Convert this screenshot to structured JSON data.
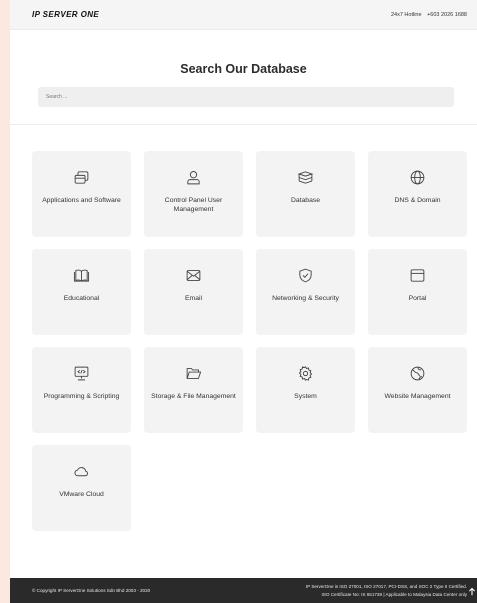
{
  "header": {
    "logo": "IP SERVER ONE",
    "hotline_label": "24x7 Hotline",
    "hotline_number": "+603 2026 1688"
  },
  "main": {
    "title": "Search Our Database",
    "search_placeholder": "Search ...",
    "categories": [
      {
        "label": "Applications and Software",
        "icon": "application-icon"
      },
      {
        "label": "Control Panel User Management",
        "icon": "user-icon"
      },
      {
        "label": "Database",
        "icon": "database-icon"
      },
      {
        "label": "DNS & Domain",
        "icon": "globe-icon"
      },
      {
        "label": "Educational",
        "icon": "book-icon"
      },
      {
        "label": "Email",
        "icon": "envelope-icon"
      },
      {
        "label": "Networking & Security",
        "icon": "shield-icon"
      },
      {
        "label": "Portal",
        "icon": "browser-window-icon"
      },
      {
        "label": "Programming & Scripting",
        "icon": "code-monitor-icon"
      },
      {
        "label": "Storage & File Management",
        "icon": "folder-icon"
      },
      {
        "label": "System",
        "icon": "gear-icon"
      },
      {
        "label": "Website Management",
        "icon": "web-globe-icon"
      },
      {
        "label": "VMware Cloud",
        "icon": "cloud-icon"
      }
    ]
  },
  "footer": {
    "copyright": "© Copyright IP ServerOne Solutions Sdn Bhd 2003 - 2020",
    "cert_line1": "IP ServerOne is ISO 27001, ISO 27017, PCI-DSS, and SOC 2 Type II Certified.",
    "cert_line2": "ISO Certificate No: IS 651738 | Applicable to Malaysia Data Center only"
  },
  "colors": {
    "outer_background": "#fbe9e1",
    "card_background": "#f3f3f3",
    "footer_background": "#2a2a2a",
    "text_dark": "#2b2b2b"
  }
}
